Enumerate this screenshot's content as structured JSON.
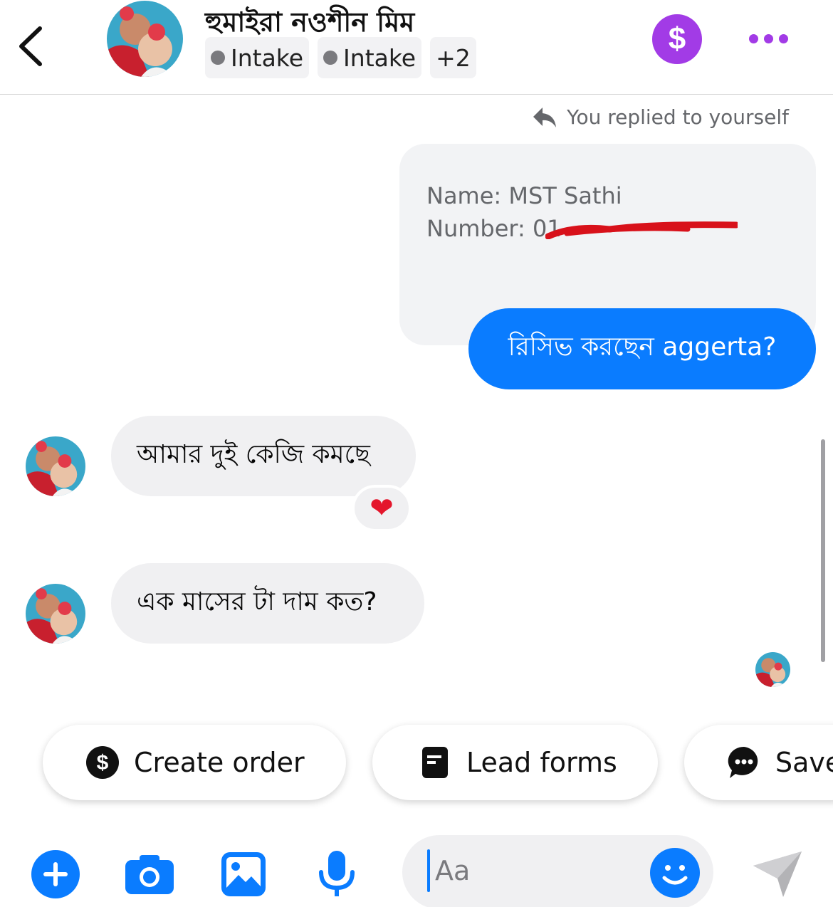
{
  "header": {
    "contact_name": "হুমাইরা নওশীন মিম",
    "labels": [
      "Intake",
      "Intake"
    ],
    "extra_labels": "+2",
    "payment_icon": "$",
    "colors": {
      "accent_purple": "#a23be6",
      "label_dot": "#7a7a7e"
    }
  },
  "thread": {
    "reply_note": "You replied to yourself",
    "quoted_message": {
      "line1": "Name: MST Sathi",
      "line2": "Number: 01"
    },
    "outgoing_message": "রিসিভ করছেন aggerta?",
    "incoming_messages": [
      {
        "text": "আমার দুই কেজি কমছে",
        "reaction": "❤"
      },
      {
        "text": "এক মাসের টা দাম কত?"
      }
    ],
    "colors": {
      "outgoing_bubble": "#0a7cff",
      "incoming_bubble": "#f0f0f2",
      "redaction": "#d8111a"
    }
  },
  "quick_actions": [
    {
      "label": "Create order",
      "icon": "dollar-circle-icon"
    },
    {
      "label": "Lead forms",
      "icon": "form-icon"
    },
    {
      "label": "Save",
      "icon": "chat-bubble-icon"
    }
  ],
  "composer": {
    "placeholder": "Aa",
    "icons": [
      "plus-icon",
      "camera-icon",
      "gallery-icon",
      "microphone-icon",
      "emoji-icon",
      "send-icon"
    ]
  }
}
